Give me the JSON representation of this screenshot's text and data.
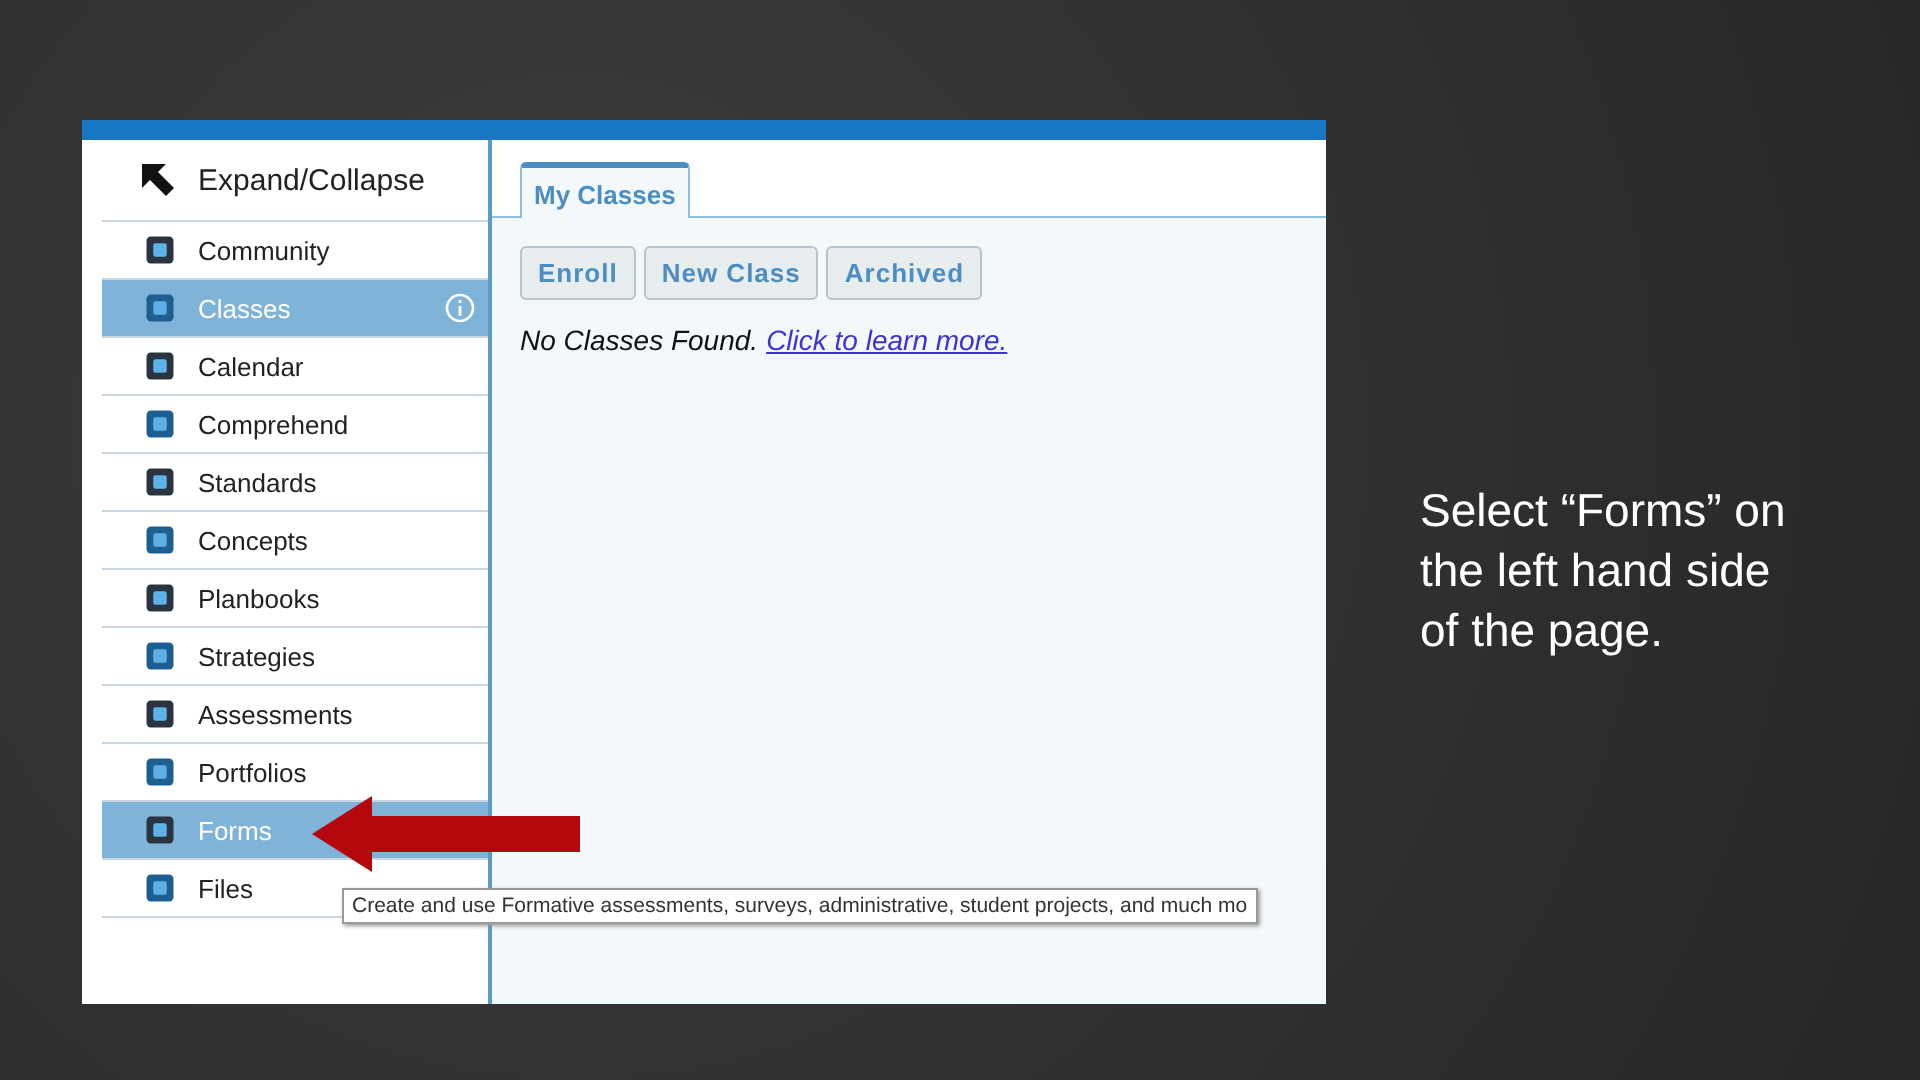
{
  "sidebar": {
    "header": "Expand/Collapse",
    "items": [
      {
        "label": "Community",
        "selected": false
      },
      {
        "label": "Classes",
        "selected": true,
        "info": true
      },
      {
        "label": "Calendar",
        "selected": false
      },
      {
        "label": "Comprehend",
        "selected": false
      },
      {
        "label": "Standards",
        "selected": false
      },
      {
        "label": "Concepts",
        "selected": false
      },
      {
        "label": "Planbooks",
        "selected": false
      },
      {
        "label": "Strategies",
        "selected": false
      },
      {
        "label": "Assessments",
        "selected": false
      },
      {
        "label": "Portfolios",
        "selected": false
      },
      {
        "label": "Forms",
        "selected": true
      },
      {
        "label": "Files",
        "selected": false
      }
    ]
  },
  "tabs": [
    {
      "label": "My Classes",
      "selected": true
    }
  ],
  "buttons": [
    "Enroll",
    "New Class",
    "Archived"
  ],
  "message": {
    "text": "No Classes Found.",
    "link": "Click to learn more."
  },
  "tooltip": "Create and use Formative assessments, surveys, administrative, student projects, and much mo",
  "slide_text": "Select “Forms” on the left hand side of the page."
}
